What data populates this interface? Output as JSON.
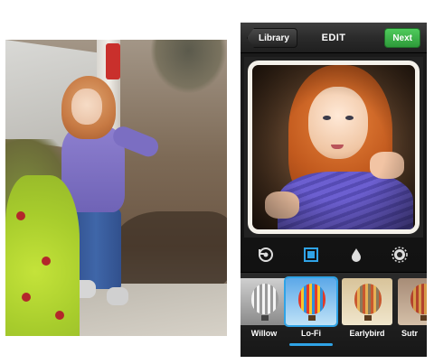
{
  "header": {
    "back_label": "Library",
    "title": "EDIT",
    "next_label": "Next"
  },
  "toolbar": {
    "tools": [
      {
        "icon": "rotate-icon"
      },
      {
        "icon": "border-frame-icon",
        "active": true
      },
      {
        "icon": "tilt-shift-drop-icon"
      },
      {
        "icon": "lux-brightness-icon"
      }
    ]
  },
  "filters": {
    "items": [
      {
        "label": "Willow",
        "selected": false
      },
      {
        "label": "Lo-Fi",
        "selected": true
      },
      {
        "label": "Earlybird",
        "selected": false
      },
      {
        "label": "Sutr",
        "selected": false
      }
    ]
  },
  "colors": {
    "accent": "#2fa3e6",
    "next_button": "#3fb54c",
    "nav_bar": "#2b2b2b"
  }
}
